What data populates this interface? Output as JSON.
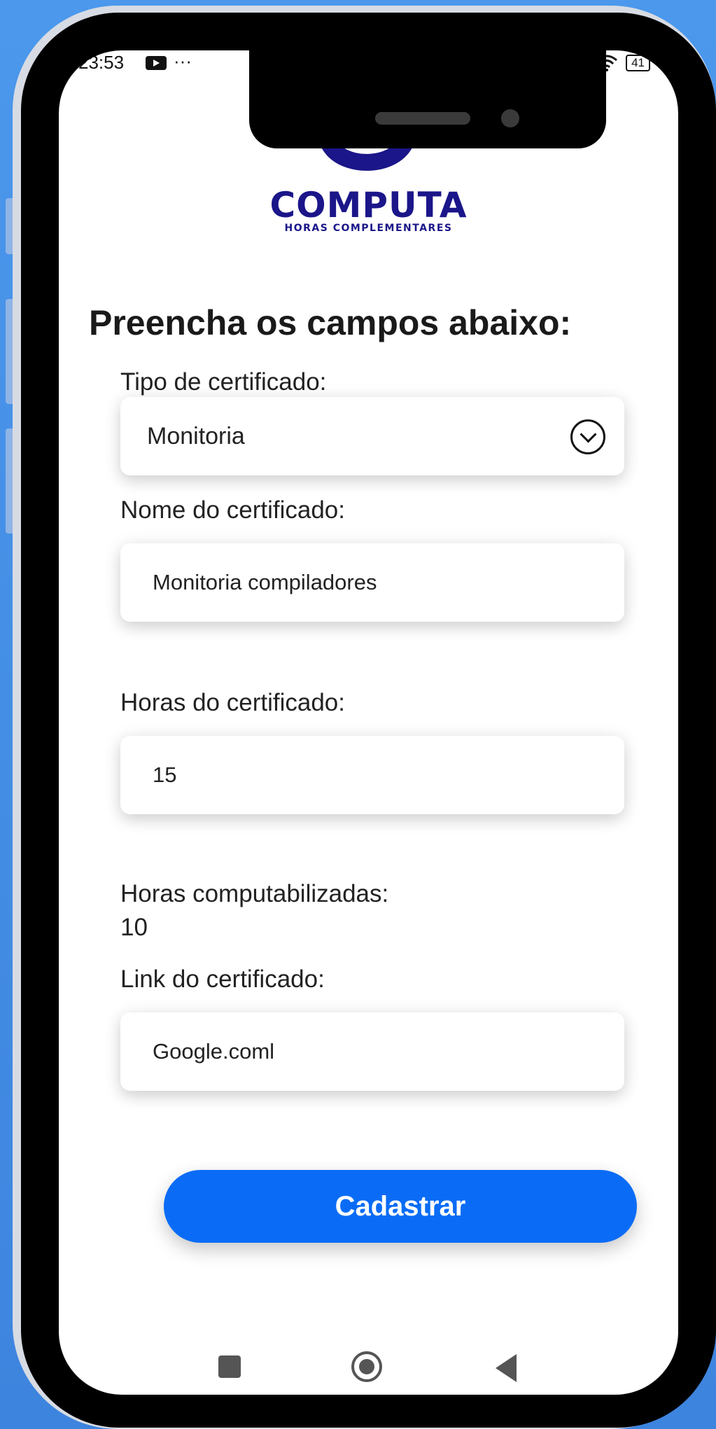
{
  "status_bar": {
    "time": "23:53",
    "dots": "···",
    "battery": "41"
  },
  "logo": {
    "title": "COMPUTA",
    "subtitle": "HORAS COMPLEMENTARES"
  },
  "form": {
    "heading": "Preencha os campos abaixo:",
    "tipo_label": "Tipo de certificado:",
    "tipo_value": "Monitoria",
    "nome_label": "Nome do certificado:",
    "nome_value": "Monitoria compiladores",
    "horas_label": "Horas do certificado:",
    "horas_value": "15",
    "computadas_label": "Horas computabilizadas:",
    "computadas_value": "10",
    "link_label": "Link do certificado:",
    "link_value": "Google.coml",
    "submit_label": "Cadastrar"
  },
  "colors": {
    "brand": "#1b1689",
    "primary": "#0a6cf6",
    "background": "#4b98ec"
  }
}
